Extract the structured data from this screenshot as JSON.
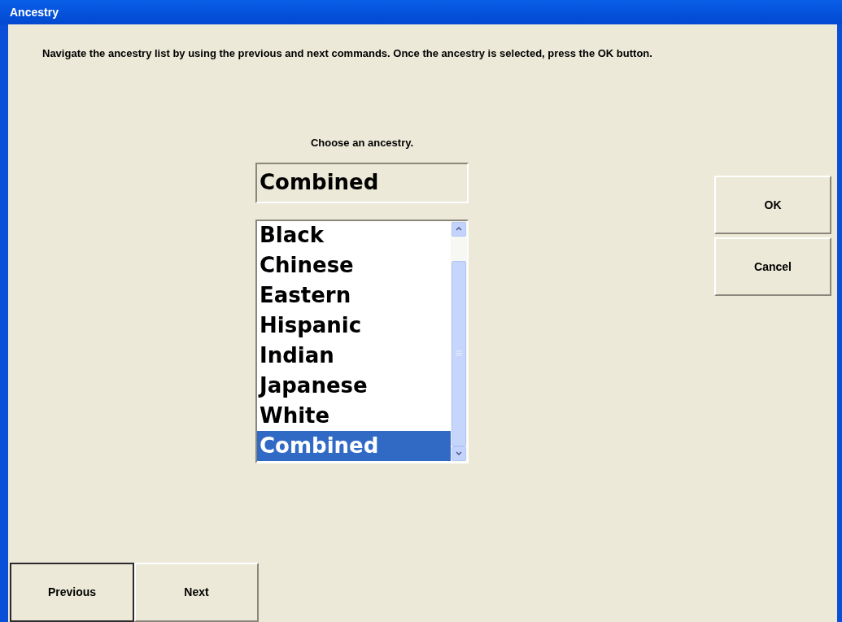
{
  "window": {
    "title": "Ancestry"
  },
  "instructions": "Navigate the ancestry list by using the previous and next commands.  Once the ancestry is selected, press the OK button.",
  "prompt": "Choose an ancestry.",
  "current_value": "Combined",
  "ancestry_list": [
    {
      "label": "Black",
      "selected": false
    },
    {
      "label": "Chinese",
      "selected": false
    },
    {
      "label": "Eastern",
      "selected": false
    },
    {
      "label": "Hispanic",
      "selected": false
    },
    {
      "label": "Indian",
      "selected": false
    },
    {
      "label": "Japanese",
      "selected": false
    },
    {
      "label": "White",
      "selected": false
    },
    {
      "label": "Combined",
      "selected": true
    }
  ],
  "side_buttons": [
    {
      "label": "OK"
    },
    {
      "label": "Cancel"
    }
  ],
  "nav_buttons": [
    {
      "label": "Previous",
      "focused": true
    },
    {
      "label": "Next",
      "focused": false
    }
  ]
}
